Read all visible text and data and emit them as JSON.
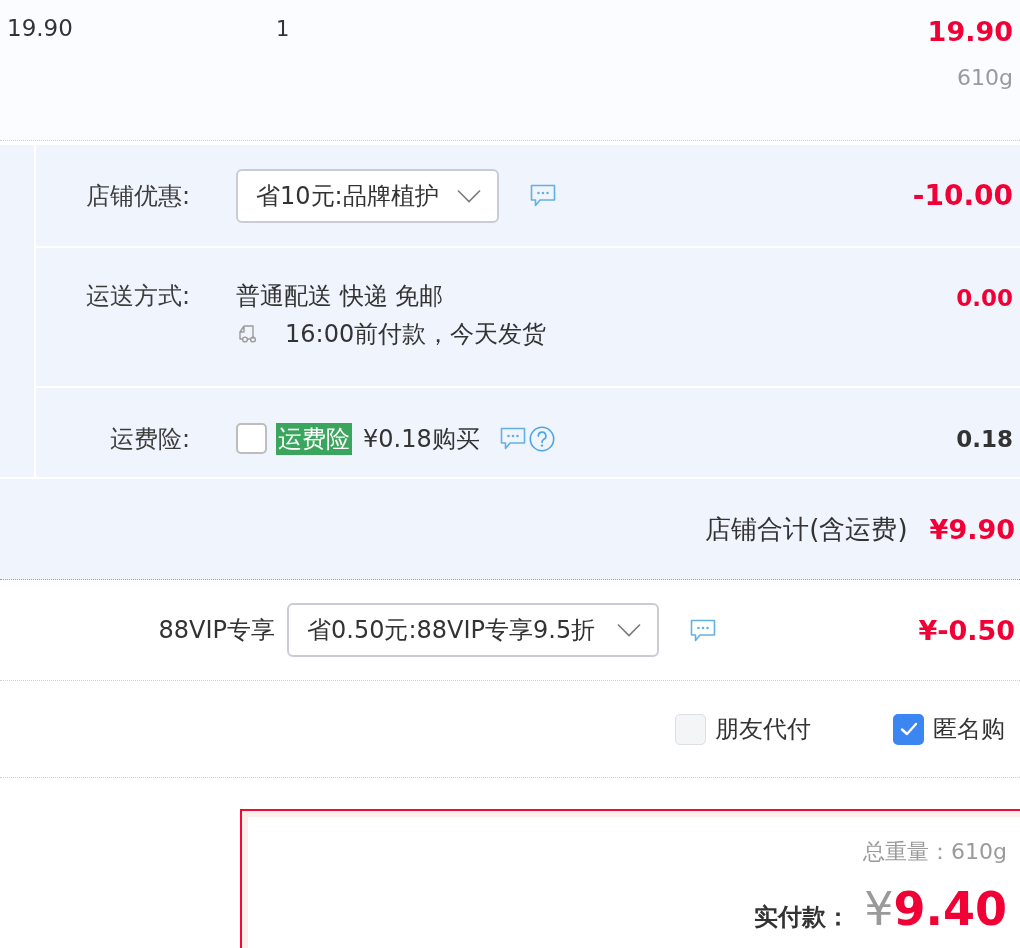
{
  "item_row": {
    "unit_price": "19.90",
    "quantity": "1",
    "subtotal": "19.90",
    "weight": "610g"
  },
  "store_section": {
    "rows": [
      {
        "kind": "select",
        "label": "店铺优惠:",
        "value": "省10元:品牌植护",
        "amount": "-10.00"
      },
      {
        "kind": "shipping",
        "label": "运送方式:",
        "method": "普通配送 快递 免邮",
        "note": "16:00前付款，今天发货",
        "amount": "0.00"
      },
      {
        "kind": "insurance",
        "label": "运费险:",
        "checked": false,
        "tag": "运费险",
        "price": "¥0.18购买",
        "amount": "0.18"
      }
    ],
    "total": {
      "label": "店铺合计(含运费)",
      "amount": "¥9.90"
    }
  },
  "vip": {
    "label": "88VIP专享",
    "value": "省0.50元:88VIP专享9.5折",
    "amount": "¥-0.50"
  },
  "options": [
    {
      "label": "朋友代付",
      "checked": false
    },
    {
      "label": "匿名购",
      "checked": true
    }
  ],
  "summary": {
    "weight": "总重量：610g",
    "pay_label": "实付款：",
    "currency": "¥",
    "amount": "9.40"
  }
}
